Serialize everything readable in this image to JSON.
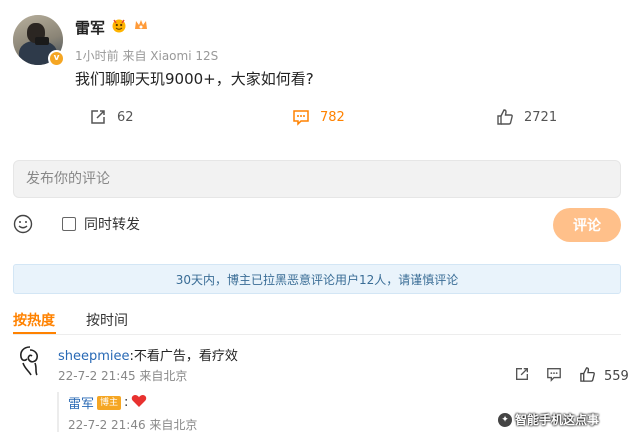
{
  "post": {
    "author": "雷军",
    "meta": "1小时前 来自 Xiaomi 12S",
    "text": "我们聊聊天玑9000+，大家如何看?",
    "verified_badge": "v",
    "badge_icons": [
      "emoji-medal-icon",
      "vip-crown-icon"
    ],
    "accent_color": "#ff8200"
  },
  "actions": {
    "share_count": "62",
    "comment_count": "782",
    "like_count": "2721"
  },
  "compose": {
    "placeholder": "发布你的评论",
    "repost_label": "同时转发",
    "submit_label": "评论"
  },
  "notice": "30天内，博主已拉黑恶意评论用户12人，请谨慎评论",
  "sort_tabs": [
    {
      "label": "按热度",
      "active": true
    },
    {
      "label": "按时间",
      "active": false
    }
  ],
  "comment": {
    "user": "sheepmiee",
    "text": ":不看广告，看疗效",
    "meta": "22-7-2 21:45 来自北京",
    "like_count": "559"
  },
  "reply": {
    "user": "雷军",
    "badge": "博主",
    "text": ":",
    "emoji": "red-heart-icon",
    "meta": "22-7-2 21:46 来自北京"
  },
  "watermark": {
    "text": "智能手机这点事"
  }
}
